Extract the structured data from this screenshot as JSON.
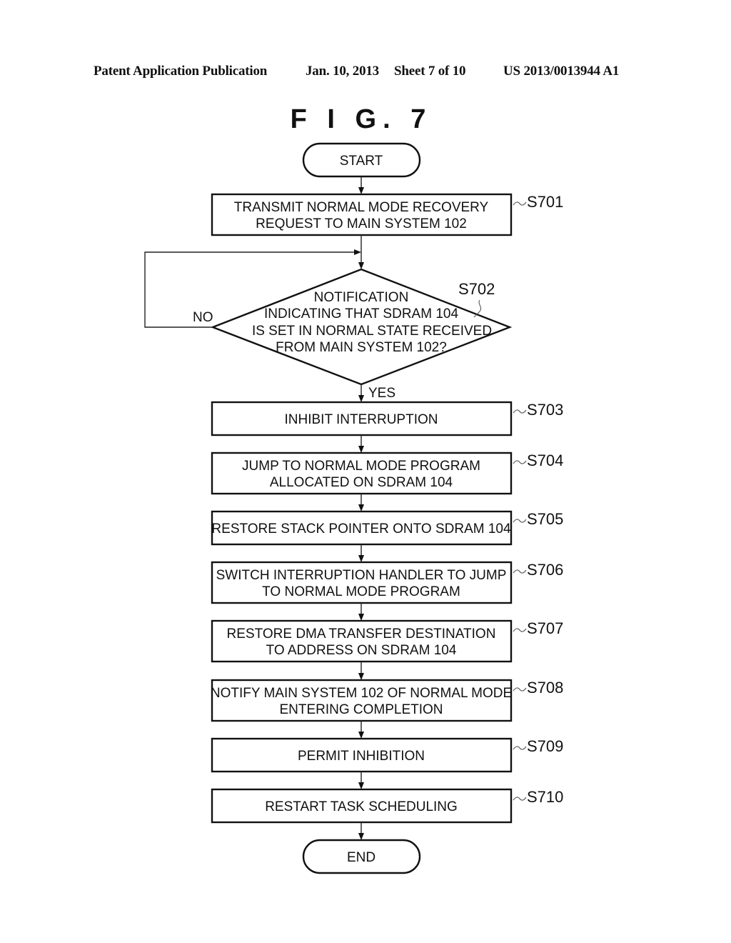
{
  "header": {
    "publication": "Patent Application Publication",
    "date": "Jan. 10, 2013",
    "sheet": "Sheet 7 of 10",
    "number": "US 2013/0013944 A1"
  },
  "figure": {
    "title": "F I G. 7",
    "start": "START",
    "end": "END",
    "decision": {
      "id": "S702",
      "lines": [
        "NOTIFICATION",
        "INDICATING THAT SDRAM 104",
        "IS SET IN NORMAL STATE RECEIVED",
        "FROM MAIN SYSTEM 102?"
      ],
      "no_label": "NO",
      "yes_label": "YES"
    },
    "steps": [
      {
        "id": "S701",
        "lines": [
          "TRANSMIT NORMAL MODE RECOVERY",
          "REQUEST TO MAIN SYSTEM 102"
        ]
      },
      {
        "id": "S703",
        "lines": [
          "INHIBIT INTERRUPTION"
        ]
      },
      {
        "id": "S704",
        "lines": [
          "JUMP TO NORMAL MODE PROGRAM",
          "ALLOCATED ON SDRAM 104"
        ]
      },
      {
        "id": "S705",
        "lines": [
          "RESTORE STACK POINTER ONTO SDRAM 104"
        ]
      },
      {
        "id": "S706",
        "lines": [
          "SWITCH INTERRUPTION HANDLER TO JUMP",
          "TO NORMAL MODE PROGRAM"
        ]
      },
      {
        "id": "S707",
        "lines": [
          "RESTORE DMA TRANSFER DESTINATION",
          "TO ADDRESS ON SDRAM 104"
        ]
      },
      {
        "id": "S708",
        "lines": [
          "NOTIFY MAIN SYSTEM 102 OF NORMAL MODE",
          "ENTERING COMPLETION"
        ]
      },
      {
        "id": "S709",
        "lines": [
          "PERMIT INHIBITION"
        ]
      },
      {
        "id": "S710",
        "lines": [
          "RESTART TASK SCHEDULING"
        ]
      }
    ]
  }
}
